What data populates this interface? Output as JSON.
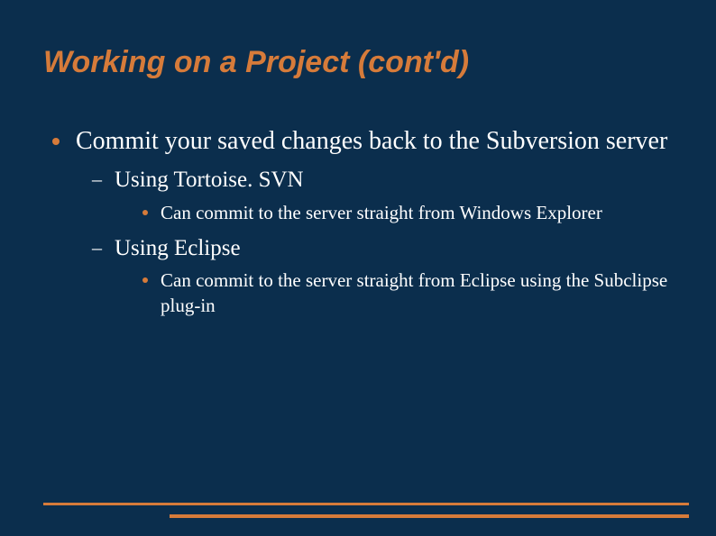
{
  "slide": {
    "title": "Working on a Project (cont'd)",
    "bullets": {
      "l1_0": "Commit your saved changes back to the Subversion server",
      "l2_0": "Using Tortoise. SVN",
      "l3_0": "Can commit to the server straight from Windows Explorer",
      "l2_1": "Using Eclipse",
      "l3_1": "Can commit to the server straight from Eclipse using the Subclipse plug-in"
    }
  },
  "colors": {
    "background": "#0b2e4d",
    "accent": "#d67b3a",
    "text": "#ffffff"
  }
}
